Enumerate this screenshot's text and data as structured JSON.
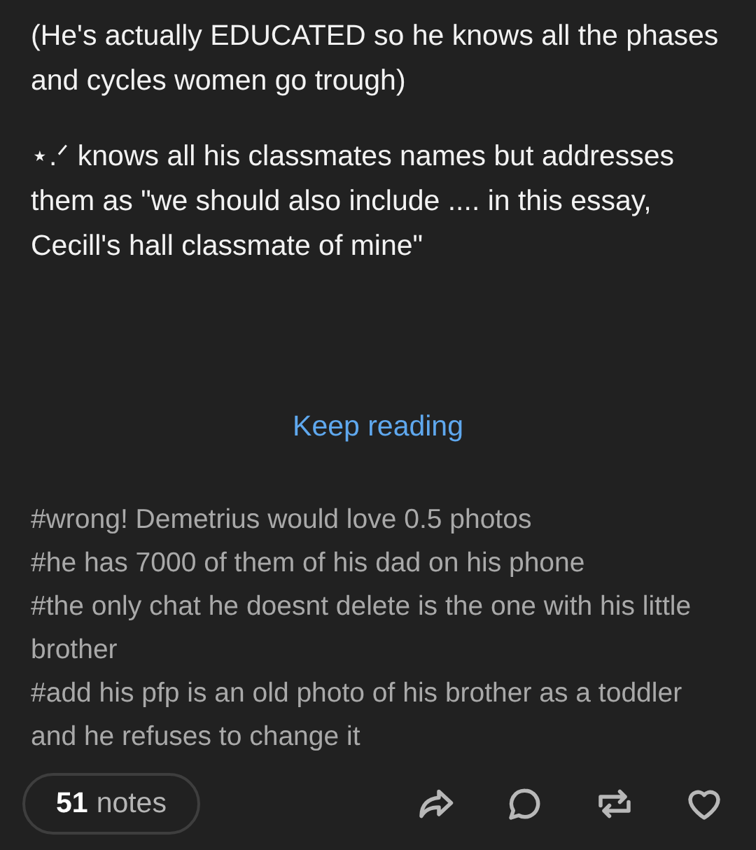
{
  "paragraphs": [
    {
      "text": "(He's actually EDUCATED so he knows all the phases and cycles women go trough)"
    },
    {
      "text": "⋆.ᐟ knows all his classmates names but addresses them as \"we should also include .... in this essay, Cecill's hall classmate of mine\""
    }
  ],
  "keep_reading": "Keep reading",
  "tags": [
    "#wrong! Demetrius would love 0.5 photos",
    "#he has 7000 of them of his dad on his phone",
    "#the only chat he doesnt delete is the one with his little brother",
    "#add his pfp is an old photo of his brother as a toddler and he refuses to change it"
  ],
  "footer": {
    "notes_count": "51",
    "notes_label": "notes",
    "actions": [
      {
        "kind": "share"
      },
      {
        "kind": "reply"
      },
      {
        "kind": "reblog"
      },
      {
        "kind": "like"
      }
    ]
  }
}
